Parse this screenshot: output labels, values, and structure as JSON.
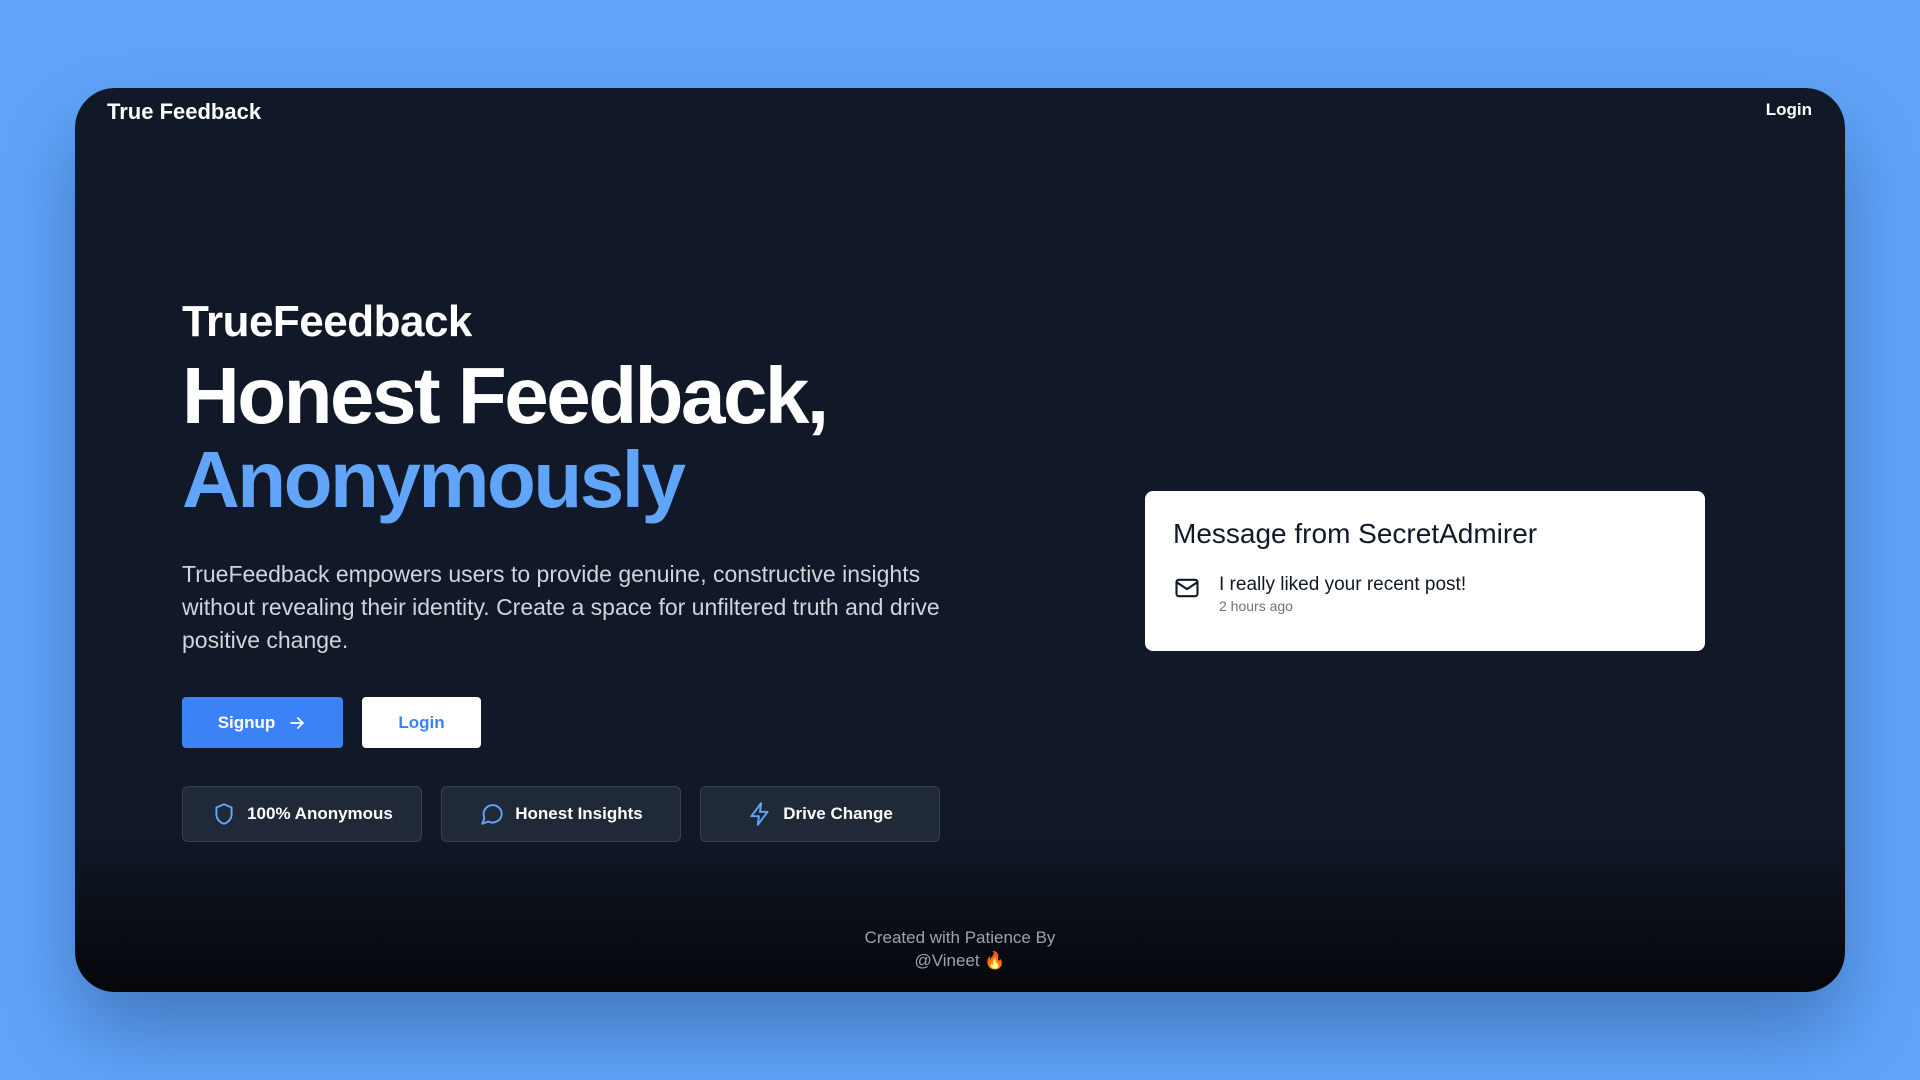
{
  "navbar": {
    "brand": "True Feedback",
    "login_label": "Login"
  },
  "hero": {
    "eyebrow": "TrueFeedback",
    "headline_line1": "Honest Feedback,",
    "headline_line2": "Anonymously",
    "description": "TrueFeedback empowers users to provide genuine, constructive insights without revealing their identity. Create a space for unfiltered truth and drive positive change.",
    "signup_label": "Signup",
    "login_label": "Login"
  },
  "features": [
    {
      "label": "100% Anonymous",
      "icon": "shield-icon"
    },
    {
      "label": "Honest Insights",
      "icon": "message-circle-icon"
    },
    {
      "label": "Drive Change",
      "icon": "lightning-bolt-icon"
    }
  ],
  "message_card": {
    "title": "Message from SecretAdmirer",
    "icon": "mail-icon",
    "content": "I really liked your recent post!",
    "time": "2 hours ago"
  },
  "footer": {
    "line1": "Created with Patience By",
    "line2": "@Vineet 🔥"
  },
  "colors": {
    "page_background": "#60a5fa",
    "window_background": "#111827",
    "accent": "#3b82f6",
    "accent_light": "#60a5fa",
    "feature_background": "#1f2937"
  }
}
